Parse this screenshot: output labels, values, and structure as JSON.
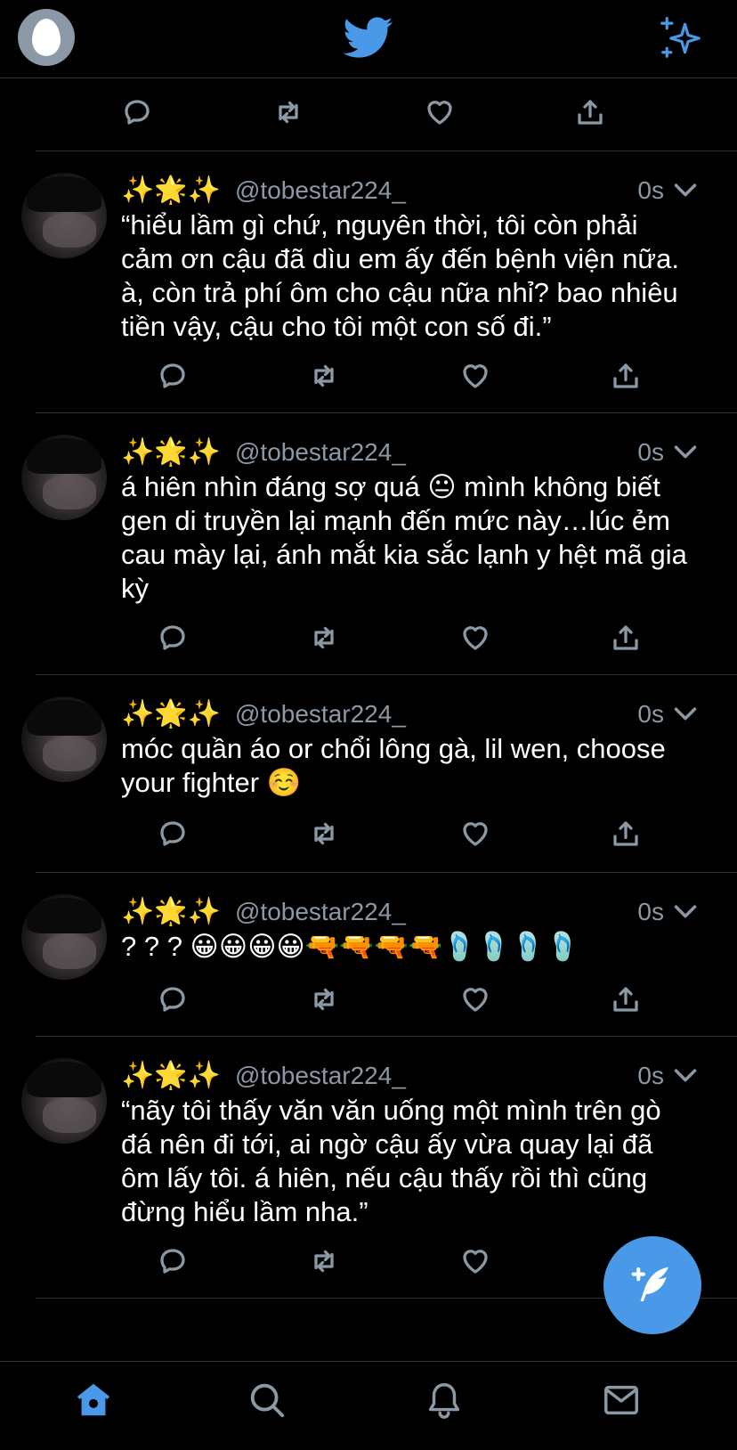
{
  "header": {
    "logo": "twitter-bird-icon",
    "right_icon": "sparkle-icon",
    "avatar": "default-egg-avatar"
  },
  "colors": {
    "accent": "#4a99e9",
    "muted": "#8b98a5",
    "divider": "#2f3336",
    "background": "#000000"
  },
  "tweets": [
    {
      "emojis": "✨🌟✨",
      "handle": "@tobestar224_",
      "time": "0s",
      "text": "“hiểu lầm gì chứ, nguyên thời, tôi còn phải cảm ơn cậu đã dìu em ấy đến bệnh viện nữa. à, còn trả phí ôm cho cậu nữa nhỉ? bao nhiêu tiền vậy, cậu cho tôi một con số đi.”"
    },
    {
      "emojis": "✨🌟✨",
      "handle": "@tobestar224_",
      "time": "0s",
      "text": "á hiên nhìn đáng sợ quá 😐 mình không biết gen di truyền lại mạnh đến mức này…lúc ẻm cau mày lại, ánh mắt kia sắc lạnh y hệt mã gia kỳ"
    },
    {
      "emojis": "✨🌟✨",
      "handle": "@tobestar224_",
      "time": "0s",
      "text": "móc quần áo or chổi lông gà, lil wen, choose your fighter ☺️"
    },
    {
      "emojis": "✨🌟✨",
      "handle": "@tobestar224_",
      "time": "0s",
      "text": "? ? ? 😀😀😀😀🔫🔫🔫🔫🩴🩴🩴🩴"
    },
    {
      "emojis": "✨🌟✨",
      "handle": "@tobestar224_",
      "time": "0s",
      "text": "“nãy tôi thấy văn văn uống một mình trên gò đá nên đi tới, ai ngờ cậu ấy vừa quay lại đã ôm lấy tôi. á hiên, nếu cậu thấy rồi thì cũng đừng hiểu lầm nha.”"
    }
  ],
  "bottom_nav": [
    "home-icon",
    "search-icon",
    "notifications-icon",
    "messages-icon"
  ],
  "fab": "compose-tweet-icon"
}
